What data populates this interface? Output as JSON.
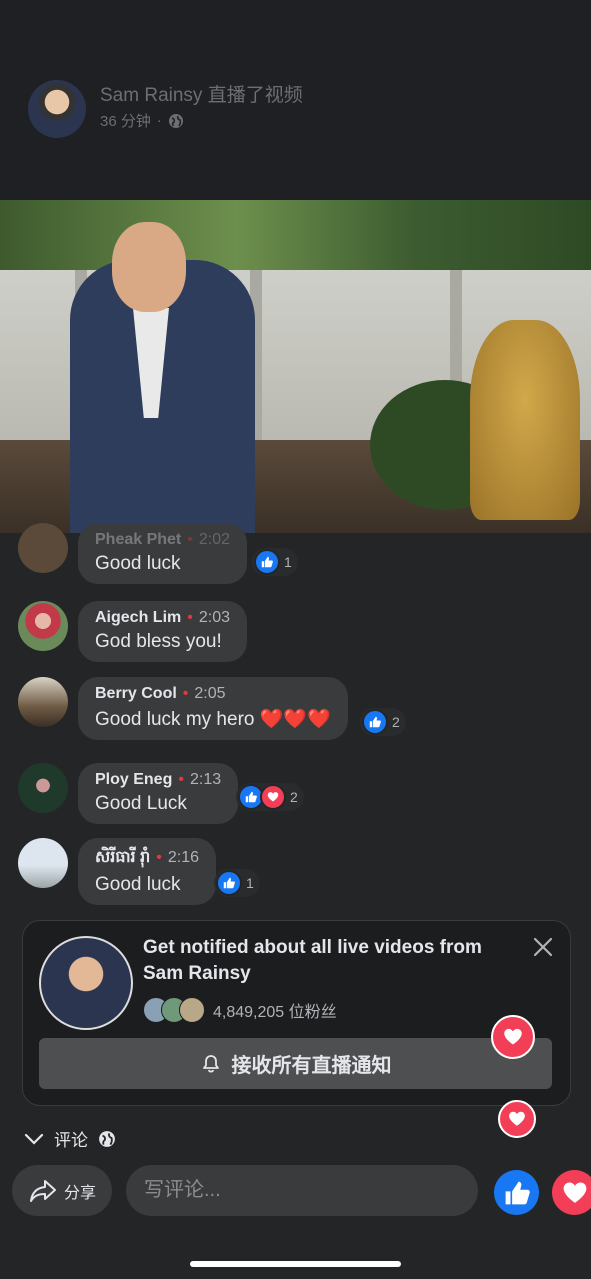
{
  "header": {
    "name": "Sam Rainsy",
    "action": "直播了视频",
    "time": "36 分钟",
    "separator": "·"
  },
  "comments": [
    {
      "name": "Pheak Phet",
      "time": "2:02",
      "text": "Good luck",
      "reactions": "1"
    },
    {
      "name": "Aigech Lim",
      "time": "2:03",
      "text": "God bless you!",
      "reactions": ""
    },
    {
      "name": "Berry Cool",
      "time": "2:05",
      "text": "Good luck my hero ❤️❤️❤️",
      "reactions": "2"
    },
    {
      "name": "Ploy Eneg",
      "time": "2:13",
      "text": "Good Luck",
      "reactions": "2"
    },
    {
      "name": "សិរីធារី រ៉ាំ",
      "time": "2:16",
      "text": "Good luck",
      "reactions": "1"
    }
  ],
  "comment_dot": "•",
  "notify": {
    "title": "Get notified about all live videos from Sam Rainsy",
    "followers": "4,849,205 位粉丝",
    "subscribe_label": "接收所有直播通知"
  },
  "comment_section_label": "评论",
  "bottom": {
    "share_label": "分享",
    "comment_placeholder": "写评论..."
  },
  "colors": {
    "background": "#242526",
    "like_blue": "#1877f2",
    "love_red": "#f33e58",
    "live_dot": "#e0393e"
  }
}
